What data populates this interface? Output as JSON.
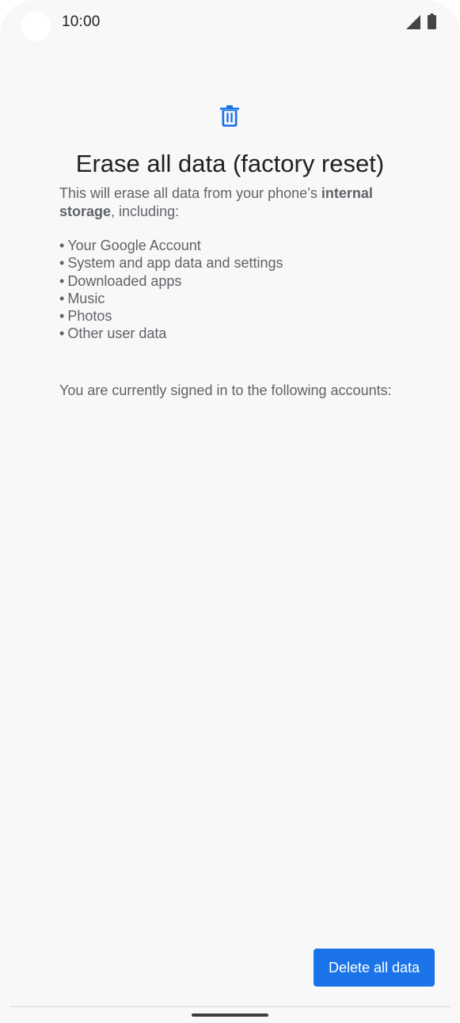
{
  "status_bar": {
    "time": "10:00",
    "icons": [
      "signal-icon",
      "battery-icon"
    ]
  },
  "header": {
    "icon": "trash-icon",
    "title": "Erase all data (factory reset)"
  },
  "intro": {
    "text_before": "This will erase all data from your phone’s ",
    "text_bold": "internal storage",
    "text_after": ", including:"
  },
  "data_items": [
    "Your Google Account",
    "System and app data and settings",
    "Downloaded apps",
    "Music",
    "Photos",
    "Other user data"
  ],
  "accounts_text": "You are currently signed in to the following accounts:",
  "actions": {
    "delete_label": "Delete all data"
  },
  "colors": {
    "accent": "#1a73e8",
    "background": "#f8f8f8",
    "title": "#202124",
    "body_text": "#5f6368"
  }
}
